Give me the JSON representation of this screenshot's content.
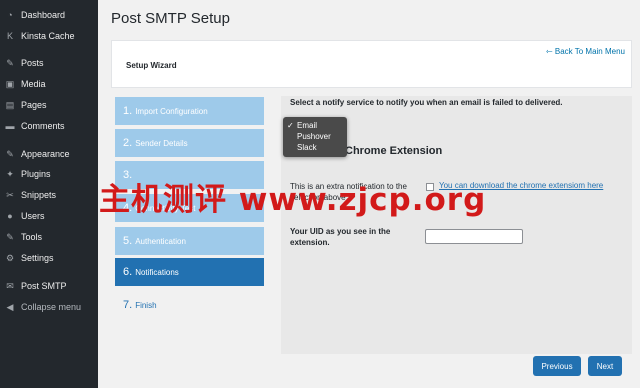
{
  "sidebar": {
    "items": [
      {
        "label": "Dashboard",
        "icon": "dashboard-icon",
        "glyph": "◔"
      },
      {
        "label": "Kinsta Cache",
        "icon": "kinsta-icon",
        "glyph": "K"
      },
      {
        "label": "Posts",
        "icon": "pin-icon",
        "glyph": "✎"
      },
      {
        "label": "Media",
        "icon": "media-icon",
        "glyph": "▣"
      },
      {
        "label": "Pages",
        "icon": "pages-icon",
        "glyph": "▤"
      },
      {
        "label": "Comments",
        "icon": "comments-icon",
        "glyph": "▬"
      },
      {
        "label": "Appearance",
        "icon": "appearance-icon",
        "glyph": "✎"
      },
      {
        "label": "Plugins",
        "icon": "plugins-icon",
        "glyph": "✦"
      },
      {
        "label": "Snippets",
        "icon": "snippets-icon",
        "glyph": "✂"
      },
      {
        "label": "Users",
        "icon": "users-icon",
        "glyph": "●"
      },
      {
        "label": "Tools",
        "icon": "tools-icon",
        "glyph": "✎"
      },
      {
        "label": "Settings",
        "icon": "settings-icon",
        "glyph": "⚙"
      },
      {
        "label": "Post SMTP",
        "icon": "post-smtp-icon",
        "glyph": "✉"
      },
      {
        "label": "Collapse menu",
        "icon": "collapse-icon",
        "glyph": "◀"
      }
    ]
  },
  "page": {
    "title": "Post SMTP Setup",
    "back_link": "⇽ Back To Main Menu",
    "wizard_title": "Setup Wizard"
  },
  "steps": [
    {
      "num": "1.",
      "label": "Import Configuration"
    },
    {
      "num": "2.",
      "label": "Sender Details"
    },
    {
      "num": "3.",
      "label": ""
    },
    {
      "num": "4.",
      "label": "Connectivity Test"
    },
    {
      "num": "5.",
      "label": "Authentication"
    },
    {
      "num": "6.",
      "label": "Notifications"
    },
    {
      "num": "7.",
      "label": "Finish"
    }
  ],
  "notify": {
    "prompt": "Select a notify service to notify you when an email is failed to delivered.",
    "options": [
      "Email",
      "Pushover",
      "Slack"
    ],
    "selected": "Email",
    "section_heading": "Chrome Extension",
    "extra_text": "This is an extra notification to the selection above",
    "download_link": "You can download the chrome extensiom here",
    "uid_label": "Your UID as you see in the extension.",
    "uid_value": ""
  },
  "buttons": {
    "previous": "Previous",
    "next": "Next"
  },
  "watermark": "主机测评 www.zjcp.org",
  "colors": {
    "sidebar_bg": "#23282d",
    "step_inactive": "#9ecaea",
    "step_active": "#2271b1",
    "button_bg": "#2271b1",
    "watermark": "#d21a1a"
  }
}
